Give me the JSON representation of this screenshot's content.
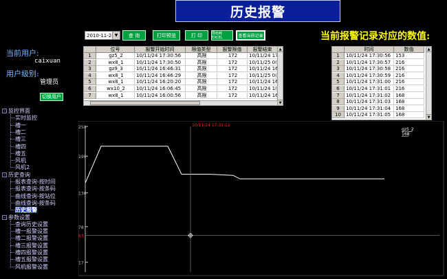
{
  "title": "历史报警",
  "date_select": "2010-11-24",
  "toolbar": [
    "查 询",
    "打印预览",
    "打 印",
    "导出到EXCEL",
    "查看当前记录"
  ],
  "right_title": "当前报警记录对应的数值:",
  "user": {
    "current_label": "当前用户:",
    "current_value": "caixuan",
    "level_label": "用户级别:",
    "level_value": "管理员",
    "switch_button": "切换用户"
  },
  "tree": [
    {
      "label": "监控界面",
      "level": 0,
      "toggle": "-"
    },
    {
      "label": "实时监控",
      "level": 1
    },
    {
      "label": "槽一",
      "level": 1
    },
    {
      "label": "槽二",
      "level": 1
    },
    {
      "label": "槽三",
      "level": 1
    },
    {
      "label": "槽四",
      "level": 1
    },
    {
      "label": "槽五",
      "level": 1
    },
    {
      "label": "风机",
      "level": 1
    },
    {
      "label": "风机2",
      "level": 1
    },
    {
      "label": "历史查询",
      "level": 0,
      "toggle": "-"
    },
    {
      "label": "报表查询-按时间",
      "level": 1
    },
    {
      "label": "报表查询-按条码",
      "level": 1
    },
    {
      "label": "曲线查询-按站位",
      "level": 1
    },
    {
      "label": "曲线查询-按条码",
      "level": 1
    },
    {
      "label": "历史报警",
      "level": 1,
      "selected": true
    },
    {
      "label": "参数设置",
      "level": 0,
      "toggle": "-"
    },
    {
      "label": "查询历史设置",
      "level": 1
    },
    {
      "label": "槽一报警设置",
      "level": 1
    },
    {
      "label": "槽二报警设置",
      "level": 1
    },
    {
      "label": "槽三报警设置",
      "level": 1
    },
    {
      "label": "槽四报警设置",
      "level": 1
    },
    {
      "label": "槽五报警设置",
      "level": 1
    },
    {
      "label": "风机报警设置",
      "level": 1
    }
  ],
  "alarm_table": {
    "headers": [
      "位号",
      "报警开始时间",
      "限值类型",
      "报警限值",
      "报警结束"
    ],
    "rows": [
      [
        "1",
        "gz5_2",
        "10/11/24 17:30:56",
        "高限",
        "172",
        "10/11/24 17"
      ],
      [
        "2",
        "wx8_1",
        "10/11/24 17:30:50",
        "高限",
        "172",
        "10/11/25 0("
      ],
      [
        "3",
        "gz9_3",
        "10/11/24 16:46:31",
        "高限",
        "172",
        "10/11/24 16"
      ],
      [
        "4",
        "wx8_1",
        "10/11/24 16:46:29",
        "高限",
        "172",
        "10/11/25 0("
      ],
      [
        "5",
        "wx8_1",
        "10/11/24 16:20:20",
        "高限",
        "172",
        "10/11/24 16"
      ],
      [
        "6",
        "wx10_2",
        "10/11/24 16:06:45",
        "高限",
        "172",
        "10/11/24 1("
      ],
      [
        "7",
        "wx8_1",
        "10/11/24 16:00:56",
        "高限",
        "172",
        "10/11/24 16"
      ]
    ]
  },
  "value_table": {
    "headers": [
      "时间",
      "数值"
    ],
    "rows": [
      [
        "1",
        "10/11/24 17:30:56",
        "153"
      ],
      [
        "2",
        "10/11/24 17:30:57",
        "216"
      ],
      [
        "3",
        "10/11/24 17:30:58",
        "216"
      ],
      [
        "4",
        "10/11/24 17:30:59",
        "216"
      ],
      [
        "5",
        "10/11/24 17:31:00",
        "216"
      ],
      [
        "6",
        "10/11/24 17:31:01",
        "216"
      ],
      [
        "7",
        "10/11/24 17:31:02",
        "168"
      ],
      [
        "8",
        "10/11/24 17:31:03",
        "168"
      ],
      [
        "9",
        "10/11/24 17:31:04",
        "168"
      ],
      [
        "10",
        "10/11/24 17:31:05",
        "168"
      ]
    ]
  },
  "chart": {
    "cursor_label": "10/11/24 17:31:12",
    "legend_name": "gz5_2",
    "legend_value": "168",
    "ylabels": [
      "250",
      "199",
      "136",
      "78",
      "17"
    ],
    "limit_label": "63",
    "colors": {
      "line": "#ffffff",
      "limit": "#ff2020",
      "cursor": "#ff2020"
    }
  },
  "chart_data": {
    "type": "line",
    "title": "",
    "xlabel": "",
    "ylabel": "",
    "ylim": [
      0,
      250
    ],
    "series": [
      {
        "values": [
          153,
          216,
          216,
          216,
          216,
          216,
          168,
          168,
          168,
          166,
          160,
          160,
          160,
          160
        ]
      }
    ],
    "limit": 63
  }
}
